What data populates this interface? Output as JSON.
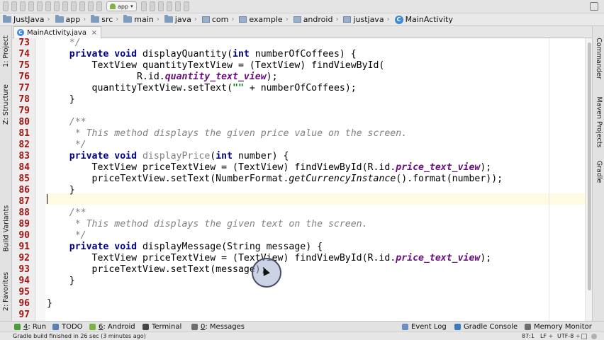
{
  "toolbar": {
    "run_config": "app"
  },
  "breadcrumb": [
    {
      "label": "JustJava",
      "icon": "folder-icon"
    },
    {
      "label": "app",
      "icon": "folder-icon"
    },
    {
      "label": "src",
      "icon": "folder-icon"
    },
    {
      "label": "main",
      "icon": "folder-icon"
    },
    {
      "label": "java",
      "icon": "folder-icon"
    },
    {
      "label": "com",
      "icon": "package-icon"
    },
    {
      "label": "example",
      "icon": "package-icon"
    },
    {
      "label": "android",
      "icon": "package-icon"
    },
    {
      "label": "justjava",
      "icon": "package-icon"
    },
    {
      "label": "MainActivity",
      "icon": "class-icon"
    }
  ],
  "editor_tab": {
    "label": "MainActivity.java",
    "icon_letter": "C"
  },
  "left_tools": [
    "1: Project",
    "Z: Structure",
    "Build Variants",
    "2: Favorites"
  ],
  "right_tools": [
    "Commander",
    "Maven Projects",
    "Gradle"
  ],
  "code_lines": [
    {
      "n": "73",
      "segs": [
        {
          "t": "    */",
          "c": "cm"
        }
      ]
    },
    {
      "n": "74",
      "segs": [
        {
          "t": "    ",
          "c": ""
        },
        {
          "t": "private void ",
          "c": "kw"
        },
        {
          "t": "displayQuantity(",
          "c": ""
        },
        {
          "t": "int ",
          "c": "kw"
        },
        {
          "t": "numberOfCoffees) {",
          "c": ""
        }
      ]
    },
    {
      "n": "75",
      "segs": [
        {
          "t": "        TextView quantityTextView = (TextView) findViewById(",
          "c": ""
        }
      ]
    },
    {
      "n": "76",
      "segs": [
        {
          "t": "                R.id.",
          "c": ""
        },
        {
          "t": "quantity_text_view",
          "c": "fld"
        },
        {
          "t": ");",
          "c": ""
        }
      ]
    },
    {
      "n": "77",
      "segs": [
        {
          "t": "        quantityTextView.setText(",
          "c": ""
        },
        {
          "t": "\"\"",
          "c": "st"
        },
        {
          "t": " + numberOfCoffees);",
          "c": ""
        }
      ]
    },
    {
      "n": "78",
      "segs": [
        {
          "t": "    }",
          "c": ""
        }
      ]
    },
    {
      "n": "79",
      "segs": []
    },
    {
      "n": "80",
      "segs": [
        {
          "t": "    /**",
          "c": "cm"
        }
      ]
    },
    {
      "n": "81",
      "segs": [
        {
          "t": "     * This method displays the given price value on the screen.",
          "c": "cm"
        }
      ]
    },
    {
      "n": "82",
      "segs": [
        {
          "t": "     */",
          "c": "cm"
        }
      ]
    },
    {
      "n": "83",
      "segs": [
        {
          "t": "    ",
          "c": ""
        },
        {
          "t": "private void ",
          "c": "kw"
        },
        {
          "t": "displayPrice",
          "c": "unused"
        },
        {
          "t": "(",
          "c": ""
        },
        {
          "t": "int ",
          "c": "kw"
        },
        {
          "t": "number) {",
          "c": ""
        }
      ]
    },
    {
      "n": "84",
      "segs": [
        {
          "t": "        TextView priceTextView = (TextView) findViewById(R.id.",
          "c": ""
        },
        {
          "t": "price_text_view",
          "c": "fld"
        },
        {
          "t": ");",
          "c": ""
        }
      ]
    },
    {
      "n": "85",
      "segs": [
        {
          "t": "        priceTextView.setText(NumberFormat.",
          "c": ""
        },
        {
          "t": "getCurrencyInstance",
          "c": "it"
        },
        {
          "t": "().format(number));",
          "c": ""
        }
      ]
    },
    {
      "n": "86",
      "segs": [
        {
          "t": "    }",
          "c": ""
        }
      ]
    },
    {
      "n": "87",
      "segs": []
    },
    {
      "n": "88",
      "segs": [
        {
          "t": "    /**",
          "c": "cm"
        }
      ]
    },
    {
      "n": "89",
      "segs": [
        {
          "t": "     * This method displays the given text on the screen.",
          "c": "cm"
        }
      ]
    },
    {
      "n": "90",
      "segs": [
        {
          "t": "     */",
          "c": "cm"
        }
      ]
    },
    {
      "n": "91",
      "segs": [
        {
          "t": "    ",
          "c": ""
        },
        {
          "t": "private void ",
          "c": "kw"
        },
        {
          "t": "displayMessage(String message) {",
          "c": ""
        }
      ]
    },
    {
      "n": "92",
      "segs": [
        {
          "t": "        TextView priceTextView = (TextView) findViewById(R.id.",
          "c": ""
        },
        {
          "t": "price_text_view",
          "c": "fld"
        },
        {
          "t": ");",
          "c": ""
        }
      ]
    },
    {
      "n": "93",
      "segs": [
        {
          "t": "        priceTextView.setText(message);",
          "c": ""
        }
      ]
    },
    {
      "n": "94",
      "segs": [
        {
          "t": "    }",
          "c": ""
        }
      ]
    },
    {
      "n": "95",
      "segs": []
    },
    {
      "n": "96",
      "segs": [
        {
          "t": "}",
          "c": ""
        }
      ]
    },
    {
      "n": "97",
      "segs": []
    }
  ],
  "bottom_tools": [
    {
      "key": "4",
      "label": ": Run",
      "icon": "run-icon",
      "color": "#4c9a3a"
    },
    {
      "key": "",
      "label": "TODO",
      "icon": "todo-icon",
      "color": "#5a7fb0"
    },
    {
      "key": "6",
      "label": ": Android",
      "icon": "android-icon",
      "color": "#7cb342"
    },
    {
      "key": "",
      "label": "Terminal",
      "icon": "terminal-icon",
      "color": "#444444"
    },
    {
      "key": "0",
      "label": ": Messages",
      "icon": "messages-icon",
      "color": "#6d6d6d"
    },
    {
      "key": "",
      "label": "Event Log",
      "icon": "event-log-icon",
      "color": "#6a8fbf"
    },
    {
      "key": "",
      "label": "Gradle Console",
      "icon": "gradle-console-icon",
      "color": "#3b7bbf"
    },
    {
      "key": "",
      "label": "Memory Monitor",
      "icon": "memory-monitor-icon",
      "color": "#6d6d6d"
    }
  ],
  "status": {
    "message": "Gradle build finished in 26 sec (3 minutes ago)",
    "position": "87:1",
    "line_sep": "LF ÷",
    "encoding": "UTF-8 ÷"
  },
  "colors": {
    "keyword": "#000080",
    "comment": "#808080",
    "field": "#660e7a",
    "string": "#008000",
    "line_number": "#a31515",
    "current_line": "#fffbe3"
  }
}
